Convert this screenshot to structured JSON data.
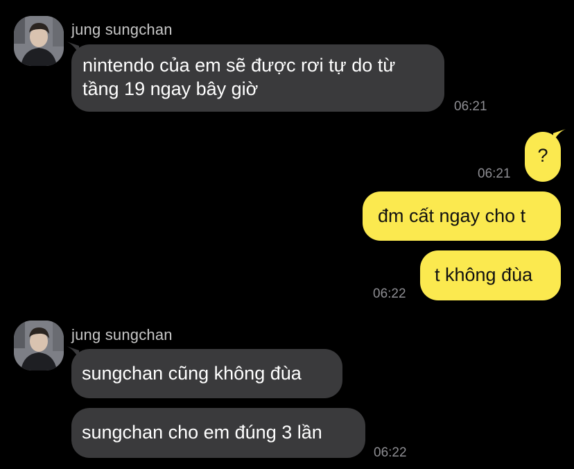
{
  "colors": {
    "background": "#000000",
    "incoming_bubble": "#3a3a3c",
    "outgoing_bubble": "#fbe94f",
    "timestamp": "#8e8e93",
    "sender_name": "#c8c8c8"
  },
  "groups": [
    {
      "sender": "jung sungchan",
      "avatar": "avatar-photo",
      "messages": [
        {
          "text": "nintendo của em sẽ được rơi tự do từ tầng 19 ngay bây giờ",
          "time": "06:21"
        }
      ]
    },
    {
      "sender": "me",
      "messages": [
        {
          "text": "?",
          "time": "06:21"
        },
        {
          "text": "đm cất ngay cho t"
        },
        {
          "text": "t không đùa",
          "time": "06:22"
        }
      ]
    },
    {
      "sender": "jung sungchan",
      "avatar": "avatar-photo",
      "messages": [
        {
          "text": "sungchan cũng không đùa"
        },
        {
          "text": "sungchan cho em đúng 3 lần",
          "time": "06:22"
        }
      ]
    }
  ]
}
